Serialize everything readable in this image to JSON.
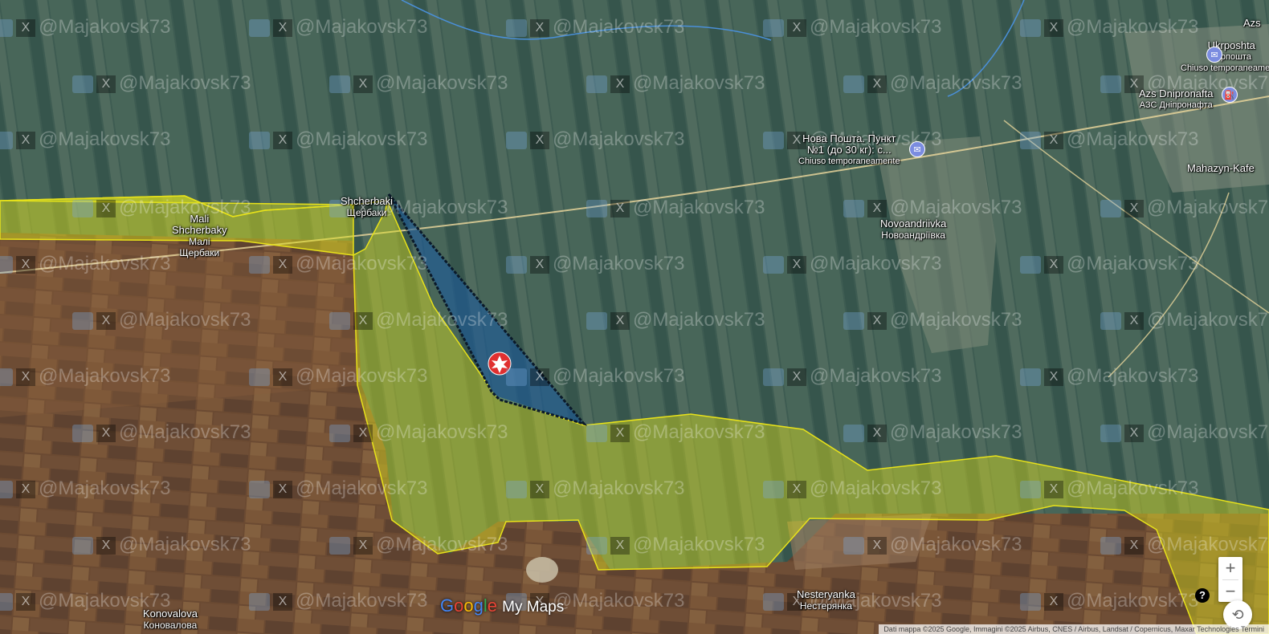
{
  "map": {
    "watermark_handle": "@Majakovsk73",
    "branding": {
      "letters": [
        "G",
        "o",
        "o",
        "g",
        "l",
        "e"
      ],
      "suffix": "My Maps"
    },
    "attribution": "Dati mappa ©2025 Google, Immagini ©2025 Airbus, CNES / Airbus, Landsat / Copernicus, Maxar Technologies  Termini",
    "colors": {
      "yellow_fill": "#d9dd1c",
      "yellow_stroke": "#e8e21a",
      "blue_fill": "#1d5a9a",
      "marker_red": "#e03030"
    },
    "labels": {
      "ukrposhta": {
        "name": "Ukrposhta",
        "local": "Укрпошта",
        "status": "Chiuso temporaneamente"
      },
      "azs": {
        "name": "Azs Dnipronafta",
        "local": "АЗС Дніпронафта"
      },
      "nova_poshta": {
        "name": "Нова Пошта. Пункт",
        "line2": "№1 (до 30 кг): с...",
        "status": "Chiuso temporaneamente"
      },
      "mahazyn": {
        "name": "Mahazyn-Kafe"
      },
      "novoandriivka": {
        "name": "Novoandriivka",
        "local": "Новоандріївка"
      },
      "shcherbaky": {
        "name": "Shcherbaki",
        "local": "Щербаки"
      },
      "mali_shcherbaky": {
        "name1": "Mali",
        "name2": "Shcherbaky",
        "local1": "Малі",
        "local2": "Щербаки"
      },
      "nesteryanka": {
        "name": "Nesteryanka",
        "local": "Нестерянка"
      },
      "konovalova": {
        "name": "Konovalova",
        "local": "Коновалова"
      },
      "edge_right": {
        "name": "Azs"
      }
    },
    "icons": {
      "ukrposhta": "mail-icon",
      "azs": "fuel-icon",
      "nova_poshta": "mail-icon",
      "marker": "explosion-icon"
    },
    "controls": {
      "zoom_in": "+",
      "zoom_out": "−",
      "help": "?",
      "pan": "⟲"
    }
  }
}
